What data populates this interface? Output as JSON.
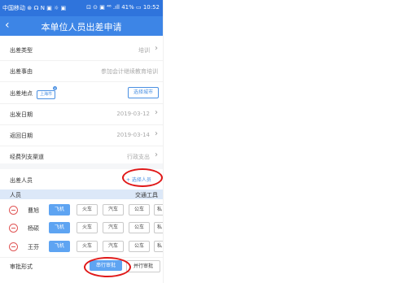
{
  "status_bar": {
    "left": "中国移动 ⊛ ☊ N ▣ ☼ ▣",
    "right": "⊡ ⊙ ▣ ⁴⁶ .ıll 41% ▭ 10:52"
  },
  "header": {
    "back_icon": "chevron-left",
    "title": "本单位人员出差申请"
  },
  "form": {
    "trip_type": {
      "label": "出差类型",
      "value": "培训"
    },
    "trip_reason": {
      "label": "出差事由",
      "value": "参加会计继续教育培训"
    },
    "trip_location": {
      "label": "出差地点",
      "tag": "上海市",
      "tag_badge": "x",
      "button": "选择城市"
    },
    "depart_date": {
      "label": "出发日期",
      "value": "2019-03-12"
    },
    "return_date": {
      "label": "返回日期",
      "value": "2019-03-14"
    },
    "expense_channel": {
      "label": "经费列支渠道",
      "value": "行政支出"
    }
  },
  "personnel": {
    "label": "出差人员",
    "select_button": "+ 选择人员",
    "columns": {
      "person": "人员",
      "transport": "交通工具"
    },
    "transport_options": [
      "飞机",
      "火车",
      "汽车",
      "公车",
      "私"
    ],
    "rows": [
      {
        "name": "曹旭",
        "selected": "飞机"
      },
      {
        "name": "杨硕",
        "selected": "飞机"
      },
      {
        "name": "王芬",
        "selected": "飞机"
      }
    ]
  },
  "approval": {
    "label": "审批形式",
    "options": [
      "串行审批",
      "并行审批"
    ],
    "selected": "串行审批"
  },
  "colors": {
    "brand_blue": "#3d85e6",
    "chip_selected": "#5ea4f2",
    "remove_red": "#e05555",
    "annotation_red": "#e01818"
  }
}
